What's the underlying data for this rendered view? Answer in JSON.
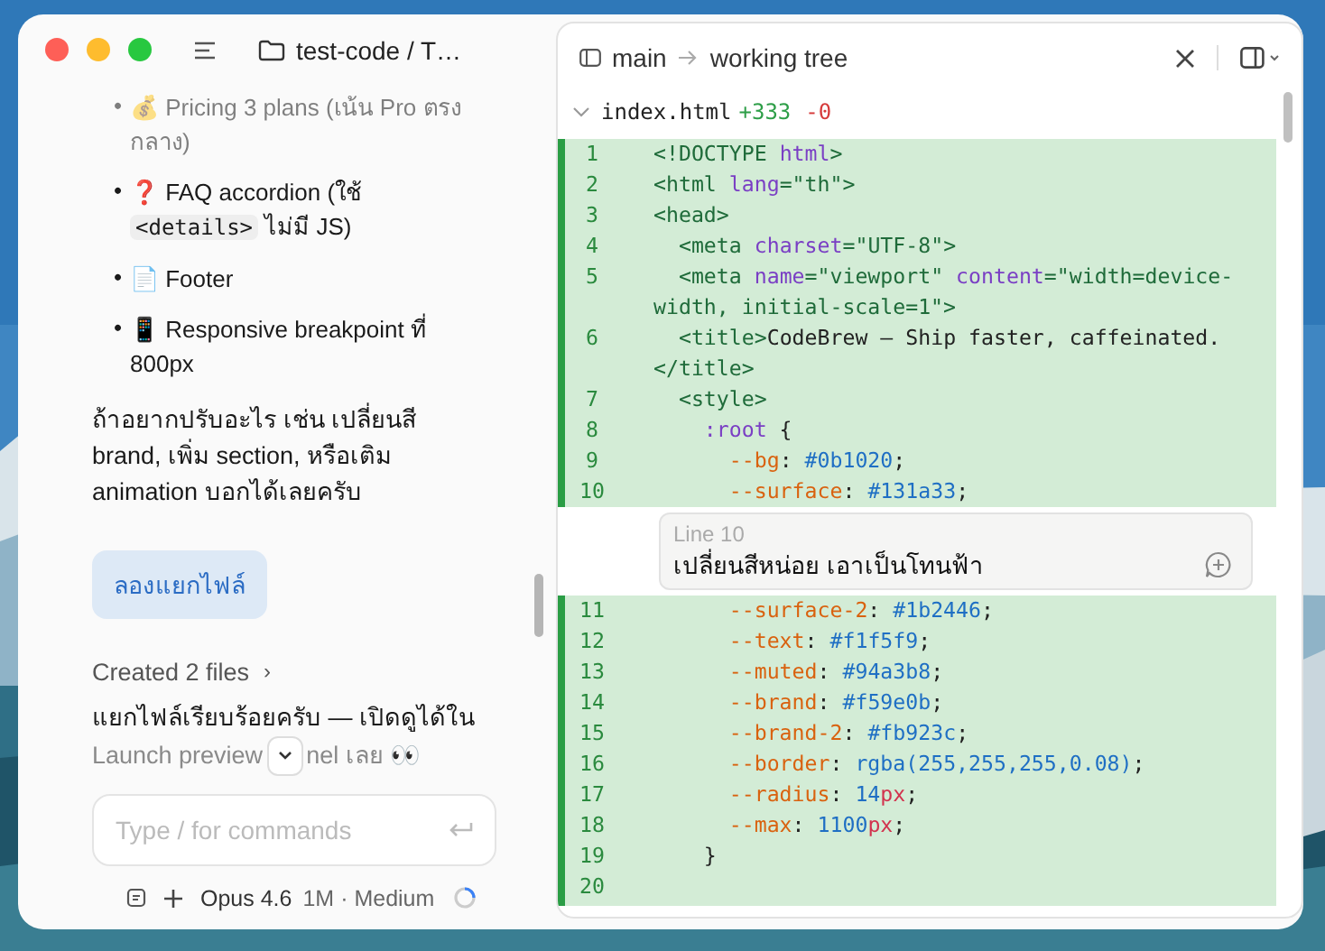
{
  "window": {
    "breadcrumb": "test-code / T…"
  },
  "chat": {
    "list": [
      {
        "bullet": "•",
        "parts": [
          {
            "t": "💰 Pricing 3 plans (เน้น Pro ตรงกลาง)"
          }
        ]
      },
      {
        "bullet": "•",
        "parts": [
          {
            "t": "❓ FAQ accordion (ใช้ "
          },
          {
            "t": "<details>",
            "code": true
          },
          {
            "t": " ไม่มี JS)"
          }
        ]
      },
      {
        "bullet": "•",
        "parts": [
          {
            "t": "📄 Footer"
          }
        ]
      },
      {
        "bullet": "•",
        "parts": [
          {
            "t": "📱 Responsive breakpoint ที่ 800px"
          }
        ]
      }
    ],
    "reply": "ถ้าอยากปรับอะไร เช่น เปลี่ยนสี brand, เพิ่ม section, หรือเติม animation บอกได้เลยครับ",
    "user_message": "ลองแยกไฟล์",
    "created": "Created 2 files",
    "created_chevron": "›",
    "final_line": "แยกไฟล์เรียบร้อยครับ — เปิดดูได้ใน",
    "final_before": "Launch preview",
    "final_after": "nel เลย 👀",
    "composer": {
      "placeholder": "Type / for commands"
    },
    "model": "Opus 4.6",
    "context": "1M · Medium"
  },
  "diff": {
    "branch": "main",
    "target": "working tree",
    "file": "index.html",
    "added": "+333",
    "removed": "-0",
    "lines": [
      {
        "num": "1",
        "tokens": [
          {
            "kind": "tag",
            "t": "<!DOCTYPE "
          },
          {
            "kind": "attr",
            "t": "html"
          },
          {
            "kind": "tag",
            "t": ">"
          }
        ]
      },
      {
        "num": "2",
        "tokens": [
          {
            "kind": "tag",
            "t": "<html "
          },
          {
            "kind": "attr",
            "t": "lang"
          },
          {
            "kind": "tag",
            "t": "=\"th\">"
          }
        ]
      },
      {
        "num": "3",
        "tokens": [
          {
            "kind": "tag",
            "t": "<head>"
          }
        ]
      },
      {
        "num": "4",
        "tokens": [
          {
            "kind": "tag",
            "t": "  <meta "
          },
          {
            "kind": "attr",
            "t": "charset"
          },
          {
            "kind": "tag",
            "t": "=\"UTF-8\">"
          }
        ]
      },
      {
        "num": "5",
        "tokens": [
          {
            "kind": "tag",
            "t": "  <meta "
          },
          {
            "kind": "attr",
            "t": "name"
          },
          {
            "kind": "tag",
            "t": "=\"viewport\" "
          },
          {
            "kind": "attr",
            "t": "content"
          },
          {
            "kind": "tag",
            "t": "=\"width=device-width, initial-scale=1\">"
          }
        ]
      },
      {
        "num": "6",
        "tokens": [
          {
            "kind": "tag",
            "t": "  <title>"
          },
          {
            "kind": "text",
            "t": "CodeBrew — Ship faster, caffeinated."
          },
          {
            "kind": "tag",
            "t": "</title>"
          }
        ]
      },
      {
        "num": "7",
        "tokens": [
          {
            "kind": "tag",
            "t": "  <style>"
          }
        ]
      },
      {
        "num": "8",
        "tokens": [
          {
            "kind": "attr",
            "t": "    :root"
          },
          {
            "kind": "text",
            "t": " {"
          }
        ]
      },
      {
        "num": "9",
        "tokens": [
          {
            "kind": "prop",
            "t": "      --bg"
          },
          {
            "kind": "text",
            "t": ": "
          },
          {
            "kind": "val",
            "t": "#0b1020"
          },
          {
            "kind": "text",
            "t": ";"
          }
        ]
      },
      {
        "num": "10",
        "tokens": [
          {
            "kind": "prop",
            "t": "      --surface"
          },
          {
            "kind": "text",
            "t": ": "
          },
          {
            "kind": "val",
            "t": "#131a33"
          },
          {
            "kind": "text",
            "t": ";"
          }
        ]
      }
    ],
    "comment": {
      "label": "Line 10",
      "value": "เปลี่ยนสีหน่อย เอาเป็นโทนฟ้า"
    },
    "lines_after": [
      {
        "num": "11",
        "tokens": [
          {
            "kind": "prop",
            "t": "      --surface-2"
          },
          {
            "kind": "text",
            "t": ": "
          },
          {
            "kind": "val",
            "t": "#1b2446"
          },
          {
            "kind": "text",
            "t": ";"
          }
        ]
      },
      {
        "num": "12",
        "tokens": [
          {
            "kind": "prop",
            "t": "      --text"
          },
          {
            "kind": "text",
            "t": ": "
          },
          {
            "kind": "val",
            "t": "#f1f5f9"
          },
          {
            "kind": "text",
            "t": ";"
          }
        ]
      },
      {
        "num": "13",
        "tokens": [
          {
            "kind": "prop",
            "t": "      --muted"
          },
          {
            "kind": "text",
            "t": ": "
          },
          {
            "kind": "val",
            "t": "#94a3b8"
          },
          {
            "kind": "text",
            "t": ";"
          }
        ]
      },
      {
        "num": "14",
        "tokens": [
          {
            "kind": "prop",
            "t": "      --brand"
          },
          {
            "kind": "text",
            "t": ": "
          },
          {
            "kind": "val",
            "t": "#f59e0b"
          },
          {
            "kind": "text",
            "t": ";"
          }
        ]
      },
      {
        "num": "15",
        "tokens": [
          {
            "kind": "prop",
            "t": "      --brand-2"
          },
          {
            "kind": "text",
            "t": ": "
          },
          {
            "kind": "val",
            "t": "#fb923c"
          },
          {
            "kind": "text",
            "t": ";"
          }
        ]
      },
      {
        "num": "16",
        "tokens": [
          {
            "kind": "prop",
            "t": "      --border"
          },
          {
            "kind": "text",
            "t": ": "
          },
          {
            "kind": "val",
            "t": "rgba(255,255,255,0.08)"
          },
          {
            "kind": "text",
            "t": ";"
          }
        ]
      },
      {
        "num": "17",
        "tokens": [
          {
            "kind": "prop",
            "t": "      --radius"
          },
          {
            "kind": "text",
            "t": ": "
          },
          {
            "kind": "val",
            "t": "14"
          },
          {
            "kind": "unit",
            "t": "px"
          },
          {
            "kind": "text",
            "t": ";"
          }
        ]
      },
      {
        "num": "18",
        "tokens": [
          {
            "kind": "prop",
            "t": "      --max"
          },
          {
            "kind": "text",
            "t": ": "
          },
          {
            "kind": "val",
            "t": "1100"
          },
          {
            "kind": "unit",
            "t": "px"
          },
          {
            "kind": "text",
            "t": ";"
          }
        ]
      },
      {
        "num": "19",
        "tokens": [
          {
            "kind": "text",
            "t": "    }"
          }
        ]
      },
      {
        "num": "20"
      }
    ]
  }
}
